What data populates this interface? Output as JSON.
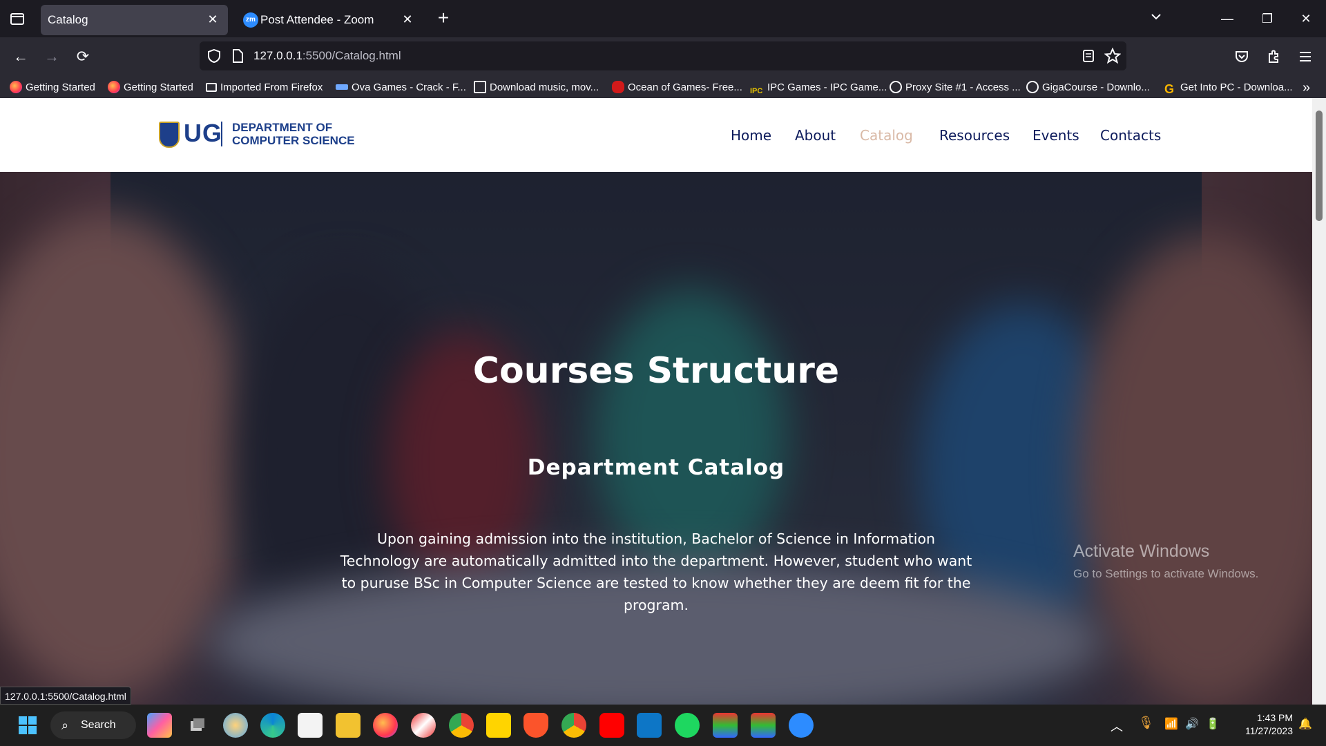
{
  "browser": {
    "tabs": [
      {
        "title": "Catalog",
        "active": true
      },
      {
        "title": "Post Attendee - Zoom",
        "active": false,
        "favicon": "zm"
      }
    ],
    "url_host": "127.0.0.1",
    "url_rest": ":5500/Catalog.html",
    "bookmarks": [
      "Getting Started",
      "Getting Started",
      "Imported From Firefox",
      "Ova Games - Crack - F...",
      "Download music, mov...",
      "Ocean of Games- Free...",
      "IPC Games - IPC Game...",
      "Proxy Site #1 - Access ...",
      "GigaCourse - Downlo...",
      "Get Into PC - Downloa..."
    ],
    "status_link": "127.0.0.1:5500/Catalog.html"
  },
  "site": {
    "logo_ug": "UG",
    "logo_line1": "DEPARTMENT OF",
    "logo_line2": "COMPUTER SCIENCE",
    "menu": [
      "Home",
      "About",
      "Catalog",
      "Resources",
      "Events",
      "Contacts"
    ],
    "current_menu": "Catalog"
  },
  "hero": {
    "title": "Courses Structure",
    "subtitle": "Department Catalog",
    "text": "Upon gaining admission into the institution, Bachelor of Science in Information Technology are automatically admitted into the department. However, student who want to puruse BSc in Computer Science are tested to know whether they are deem fit for the program."
  },
  "watermark": {
    "line1": "Activate Windows",
    "line2": "Go to Settings to activate Windows."
  },
  "taskbar": {
    "search_label": "Search",
    "time": "1:43 PM",
    "date": "11/27/2023"
  },
  "colors": {
    "nav_text": "#0c1a5b",
    "nav_current": "#d9b9a6",
    "logo_blue": "#1d3f8a"
  }
}
